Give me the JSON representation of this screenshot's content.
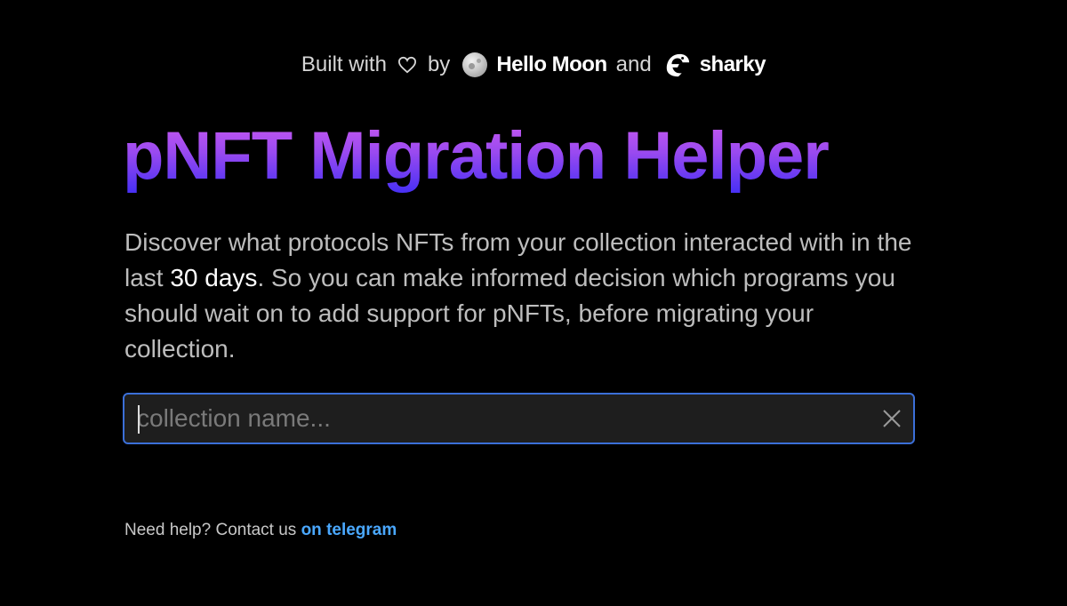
{
  "credits": {
    "built_with": "Built with",
    "by": "by",
    "brand1": "Hello Moon",
    "and": "and",
    "brand2": "sharky",
    "icons": [
      "heart-icon",
      "moon-logo-icon",
      "shark-logo-icon"
    ]
  },
  "title": "pNFT Migration Helper",
  "description": {
    "part1": "Discover what protocols NFTs from your collection interacted with in the last ",
    "highlight": "30 days",
    "part2": ". So you can make informed decision which programs you should wait on to add support for pNFTs, before migrating your collection."
  },
  "search": {
    "placeholder": "collection name...",
    "value": ""
  },
  "help": {
    "text": "Need help? Contact us ",
    "link": "on telegram"
  },
  "colors": {
    "background": "#000000",
    "title_gradient_top": "#d35cf0",
    "title_gradient_bottom": "#3b2cf5",
    "input_border": "#3b6fd8",
    "link": "#4aa8ff"
  }
}
